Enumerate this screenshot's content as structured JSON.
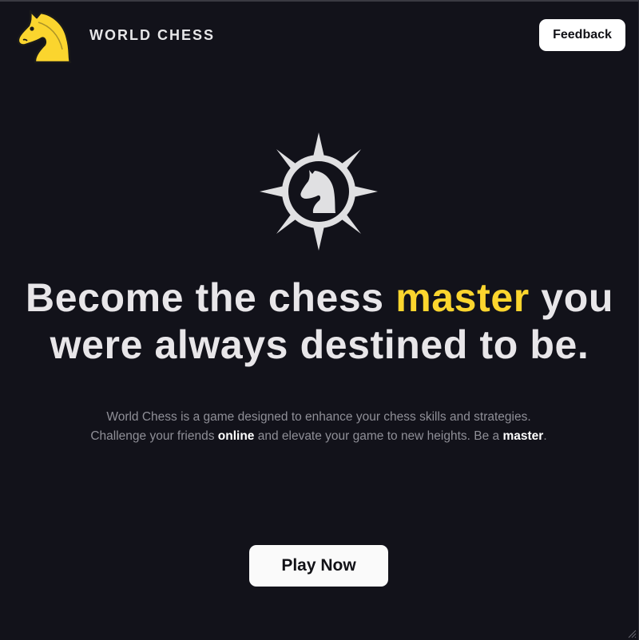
{
  "header": {
    "brand_name": "WORLD CHESS",
    "logo_icon": "knight-logo-icon",
    "feedback_label": "Feedback"
  },
  "hero": {
    "emblem_icon": "compass-knight-icon",
    "headline": {
      "part1": "Become the chess ",
      "accent": "master",
      "part2": " you were always destined to be."
    },
    "description": {
      "part1": "World Chess is a game designed to enhance your chess skills and strategies. Challenge your friends ",
      "bold1": "online",
      "part2": " and elevate your game to new heights. Be a ",
      "bold2": "master",
      "part3": "."
    },
    "cta_label": "Play Now"
  },
  "colors": {
    "background": "#12121a",
    "accent": "#fbd52e",
    "text": "#e8e6e9",
    "muted": "#8f8f97",
    "button_bg": "#ffffff"
  }
}
